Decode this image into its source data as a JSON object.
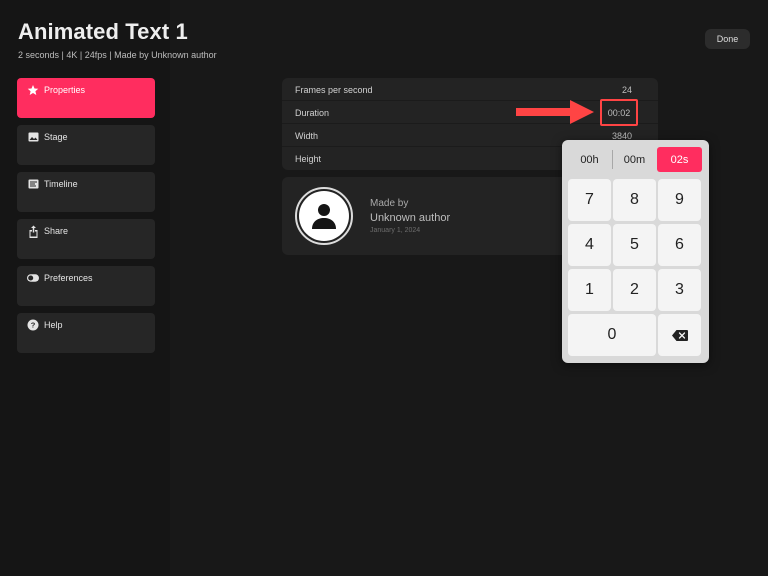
{
  "header": {
    "title": "Animated Text 1",
    "subtitle": "2 seconds  |  4K  |  24fps  |  Made by Unknown author",
    "done_label": "Done"
  },
  "sidebar": {
    "items": [
      {
        "label": "Properties",
        "icon": "star-icon",
        "active": true
      },
      {
        "label": "Stage",
        "icon": "image-icon",
        "active": false
      },
      {
        "label": "Timeline",
        "icon": "timeline-icon",
        "active": false
      },
      {
        "label": "Share",
        "icon": "share-icon",
        "active": false
      },
      {
        "label": "Preferences",
        "icon": "toggle-icon",
        "active": false
      },
      {
        "label": "Help",
        "icon": "help-icon",
        "active": false
      }
    ]
  },
  "properties": {
    "rows": [
      {
        "label": "Frames per second",
        "value": "24"
      },
      {
        "label": "Duration",
        "value": "00:02"
      },
      {
        "label": "Width",
        "value": "3840"
      },
      {
        "label": "Height",
        "value": ""
      }
    ]
  },
  "author": {
    "made_by_label": "Made by",
    "name": "Unknown author",
    "date": "January 1, 2024"
  },
  "keypad": {
    "hours": "00h",
    "minutes": "00m",
    "seconds": "02s",
    "keys": [
      "7",
      "8",
      "9",
      "4",
      "5",
      "6",
      "1",
      "2",
      "3",
      "0"
    ]
  },
  "colors": {
    "accent": "#ff2d5f",
    "highlight": "#ff4444",
    "background": "#151515",
    "card": "#232323"
  }
}
